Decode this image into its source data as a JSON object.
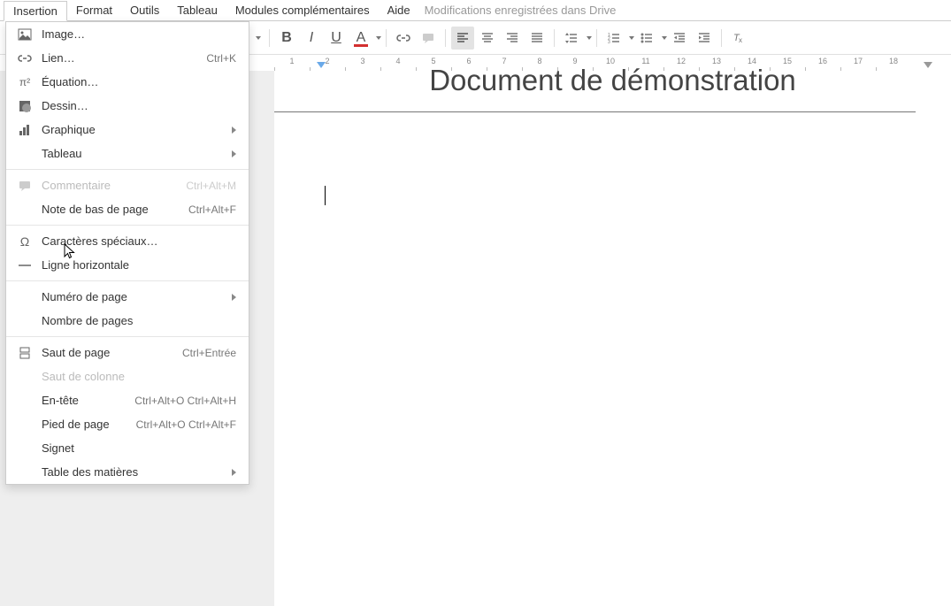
{
  "menubar": {
    "items": [
      "Insertion",
      "Format",
      "Outils",
      "Tableau",
      "Modules complémentaires",
      "Aide"
    ],
    "save_status": "Modifications enregistrées dans Drive"
  },
  "dropdown": {
    "image": "Image…",
    "lien": "Lien…",
    "lien_shortcut": "Ctrl+K",
    "equation": "Équation…",
    "dessin": "Dessin…",
    "graphique": "Graphique",
    "tableau": "Tableau",
    "commentaire": "Commentaire",
    "commentaire_shortcut": "Ctrl+Alt+M",
    "note_bas": "Note de bas de page",
    "note_bas_shortcut": "Ctrl+Alt+F",
    "caracteres": "Caractères spéciaux…",
    "ligne_horiz": "Ligne horizontale",
    "num_page": "Numéro de page",
    "nb_pages": "Nombre de pages",
    "saut_page": "Saut de page",
    "saut_page_shortcut": "Ctrl+Entrée",
    "saut_colonne": "Saut de colonne",
    "entete": "En-tête",
    "entete_shortcut": "Ctrl+Alt+O Ctrl+Alt+H",
    "pied": "Pied de page",
    "pied_shortcut": "Ctrl+Alt+O Ctrl+Alt+F",
    "signet": "Signet",
    "table_mat": "Table des matières"
  },
  "document": {
    "title": "Document de démonstration"
  },
  "ruler": {
    "ticks": [
      "1",
      "2",
      "3",
      "4",
      "5",
      "6",
      "7",
      "8",
      "9",
      "10",
      "11",
      "12",
      "13",
      "14",
      "15",
      "16",
      "17",
      "18"
    ]
  }
}
